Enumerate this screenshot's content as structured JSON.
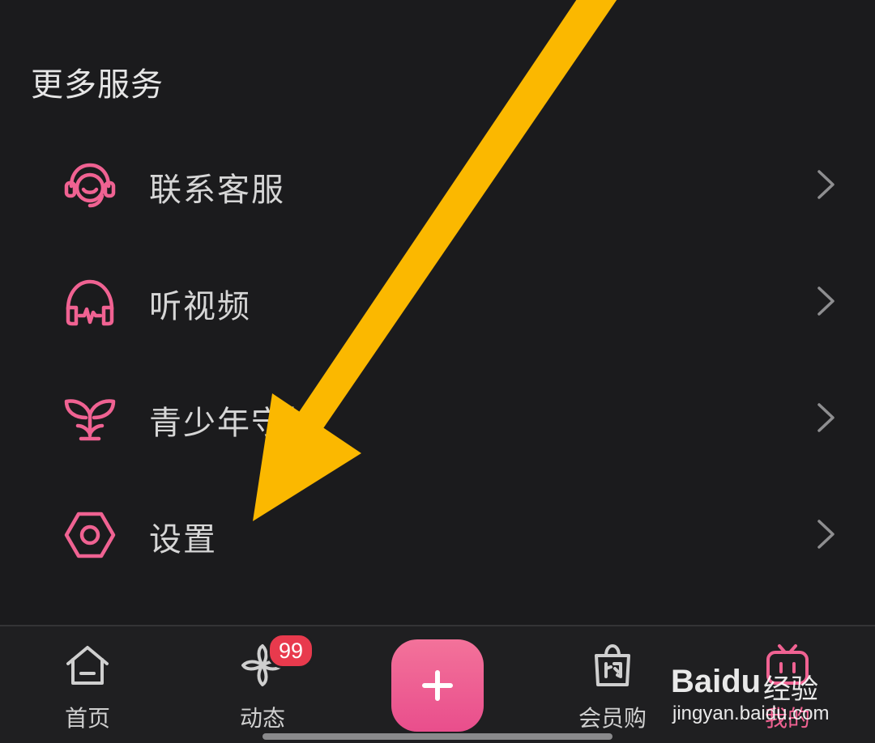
{
  "section": {
    "title": "更多服务"
  },
  "menu": {
    "items": [
      {
        "label": "联系客服",
        "icon": "headset-icon"
      },
      {
        "label": "听视频",
        "icon": "headphones-icon"
      },
      {
        "label": "青少年守护",
        "icon": "sprout-icon"
      },
      {
        "label": "设置",
        "icon": "hexagon-gear-icon"
      }
    ]
  },
  "tabbar": {
    "items": [
      {
        "label": "首页",
        "icon": "home-icon"
      },
      {
        "label": "动态",
        "icon": "pinwheel-icon",
        "badge": "99"
      },
      {
        "label": "",
        "icon": "plus-icon"
      },
      {
        "label": "会员购",
        "icon": "shopping-bag-icon"
      },
      {
        "label": "我的",
        "icon": "tv-icon",
        "active": true
      }
    ]
  },
  "watermark": {
    "logo": "Baidu",
    "brand": "经验",
    "url": "jingyan.baidu.com"
  },
  "colors": {
    "background": "#1b1b1d",
    "accent": "#f06292",
    "arrow": "#fbb800",
    "badge": "#e83a4d",
    "text": "#d6d6d6"
  }
}
